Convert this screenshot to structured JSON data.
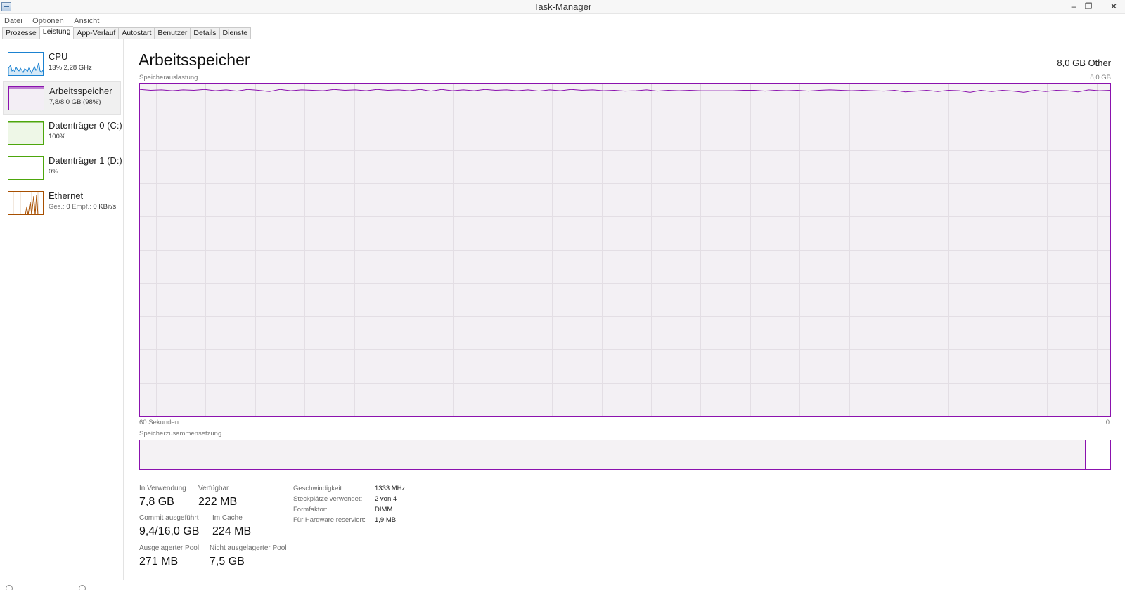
{
  "window": {
    "title": "Task-Manager",
    "minimize_glyph": "–",
    "restore_glyph": "❐",
    "close_glyph": "✕"
  },
  "menu": [
    "Datei",
    "Optionen",
    "Ansicht"
  ],
  "tabs": [
    "Prozesse",
    "Leistung",
    "App-Verlauf",
    "Autostart",
    "Benutzer",
    "Details",
    "Dienste"
  ],
  "active_tab": "Leistung",
  "sidebar": {
    "items": [
      {
        "name": "CPU",
        "sub": "13% 2,28 GHz",
        "color": "#1b82d1"
      },
      {
        "name": "Arbeitsspeicher",
        "sub": "7,8/8,0 GB (98%)",
        "color": "#8b12ae"
      },
      {
        "name": "Datenträger 0 (C:)",
        "sub": "100%",
        "color": "#4da60c"
      },
      {
        "name": "Datenträger 1 (D:)",
        "sub": "0%",
        "color": "#4da60c"
      },
      {
        "name": "Ethernet",
        "sub_a_label": "Ges.:",
        "sub_a_value": "0",
        "sub_b_label": "Empf.:",
        "sub_b_value": "0 KBit/s",
        "color": "#a74f01"
      }
    ]
  },
  "main": {
    "title": "Arbeitsspeicher",
    "capacity": "8,0 GB Other",
    "usage_label": "Speicherauslastung",
    "usage_max": "8,0 GB",
    "time_left": "60 Sekunden",
    "time_right": "0",
    "composition_label": "Speicherzusammensetzung",
    "accent_color": "#8b12ae",
    "graph_max_gb": 8.0,
    "usage_series_gb": [
      7.86,
      7.84,
      7.85,
      7.83,
      7.85,
      7.84,
      7.86,
      7.83,
      7.85,
      7.82,
      7.86,
      7.84,
      7.81,
      7.86,
      7.83,
      7.85,
      7.84,
      7.83,
      7.86,
      7.84,
      7.85,
      7.83,
      7.86,
      7.84,
      7.85,
      7.83,
      7.86,
      7.82,
      7.86,
      7.83,
      7.85,
      7.83,
      7.86,
      7.84,
      7.85,
      7.83,
      7.85,
      7.82,
      7.85,
      7.83,
      7.86,
      7.84,
      7.85,
      7.83,
      7.84,
      7.82,
      7.83,
      7.85,
      7.82,
      7.84,
      7.83,
      7.84,
      7.83,
      7.83,
      7.83,
      7.83,
      7.84,
      7.84,
      7.82,
      7.84,
      7.83,
      7.84,
      7.82,
      7.84,
      7.85,
      7.84,
      7.83,
      7.84,
      7.83,
      7.82,
      7.84,
      7.8,
      7.82,
      7.84,
      7.81,
      7.84,
      7.83,
      7.79,
      7.84,
      7.81,
      7.84,
      7.82,
      7.79,
      7.84,
      7.81,
      7.84,
      7.83,
      7.8,
      7.85,
      7.83,
      7.84
    ],
    "stats": {
      "in_use_label": "In Verwendung",
      "in_use_value": "7,8 GB",
      "available_label": "Verfügbar",
      "available_value": "222 MB",
      "committed_label": "Commit ausgeführt",
      "committed_value": "9,4/16,0 GB",
      "cached_label": "Im Cache",
      "cached_value": "224 MB",
      "paged_label": "Ausgelagerter Pool",
      "paged_value": "271 MB",
      "nonpaged_label": "Nicht ausgelagerter Pool",
      "nonpaged_value": "7,5 GB"
    },
    "specs": [
      {
        "label": "Geschwindigkeit:",
        "value": "1333 MHz"
      },
      {
        "label": "Steckplätze verwendet:",
        "value": "2 von 4"
      },
      {
        "label": "Formfaktor:",
        "value": "DIMM"
      },
      {
        "label": "Für Hardware reserviert:",
        "value": "1,9 MB"
      }
    ]
  }
}
